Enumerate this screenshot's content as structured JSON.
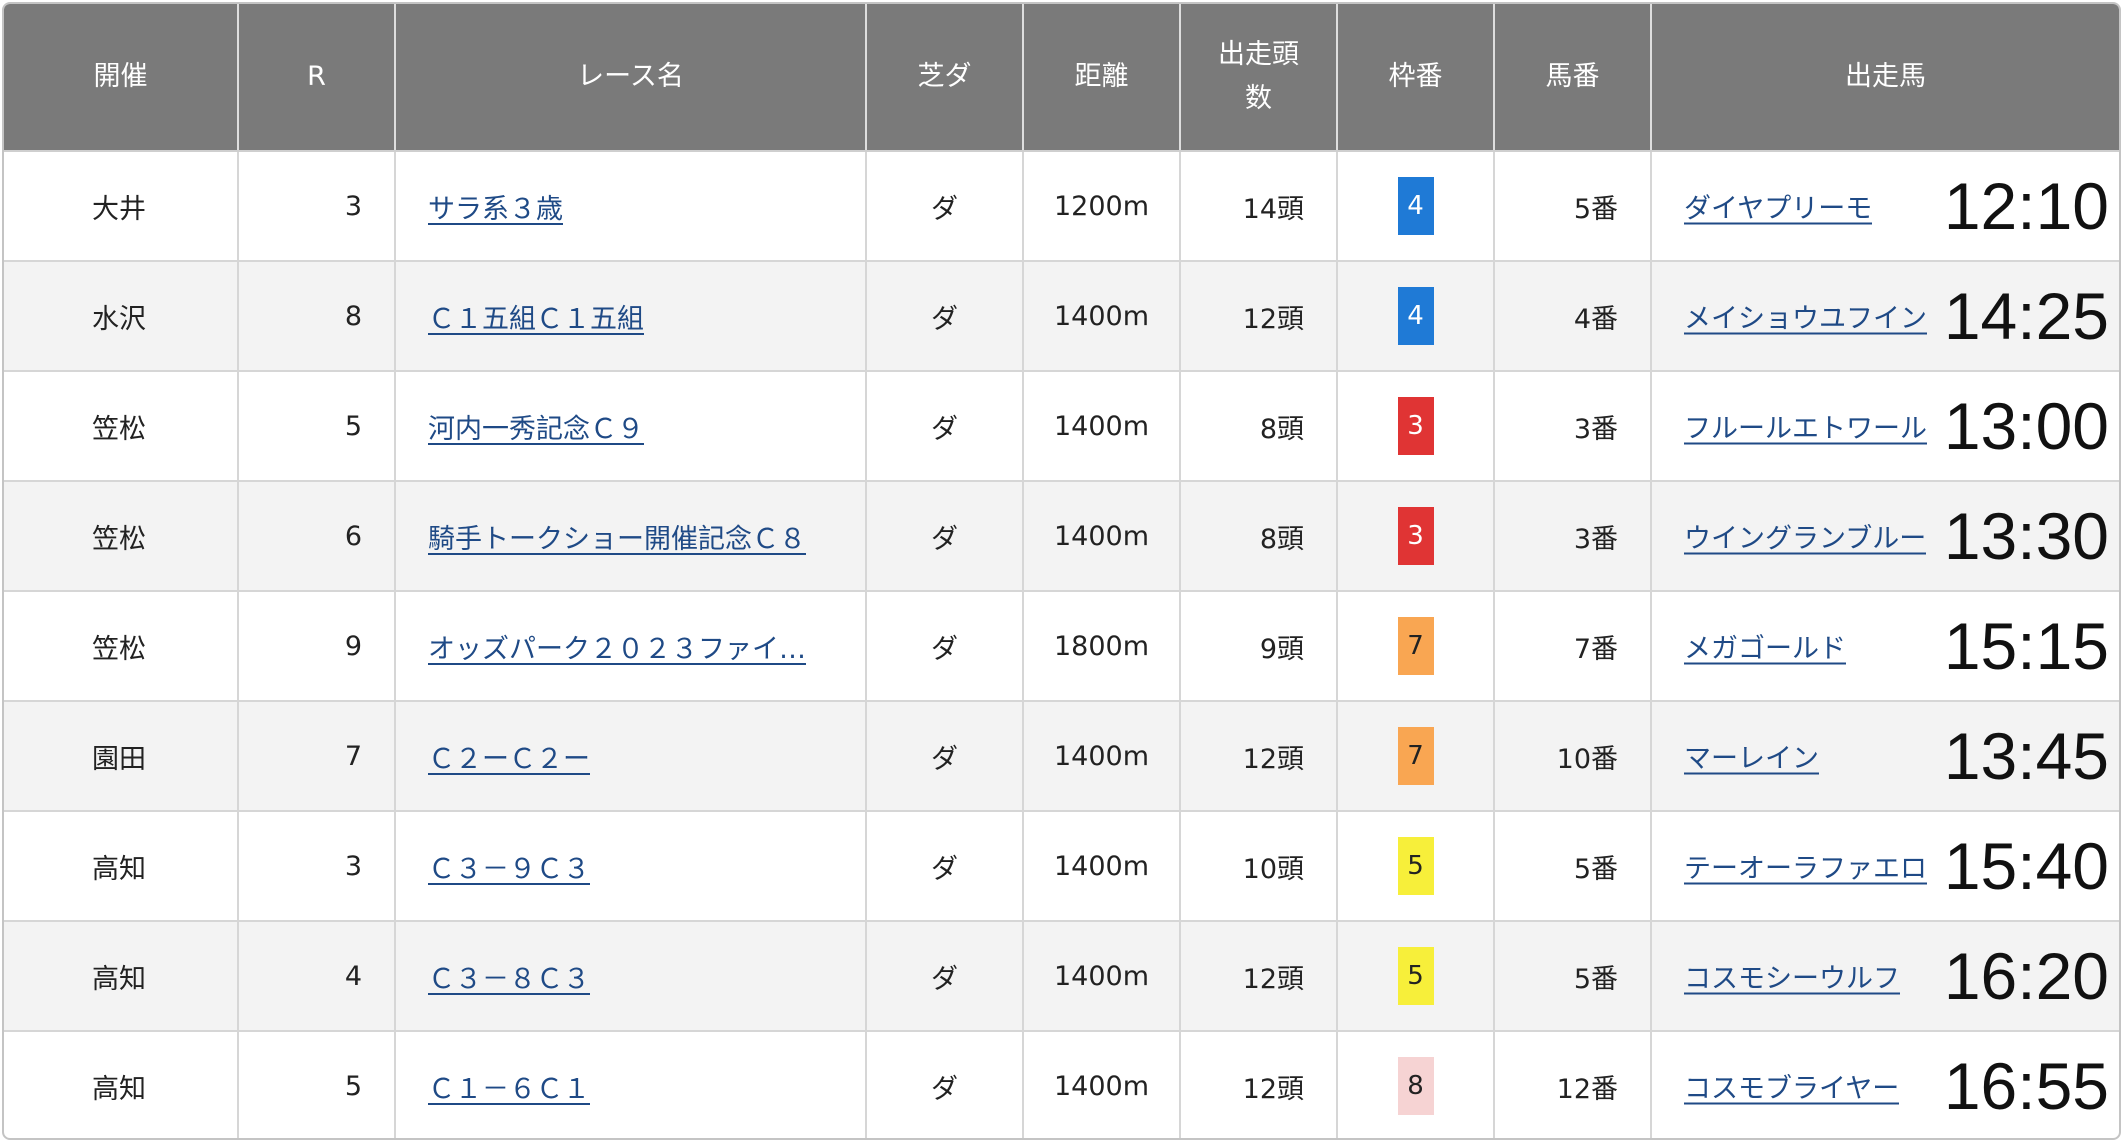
{
  "headers": [
    "開催",
    "R",
    "レース名",
    "芝ダ",
    "距離",
    "出走頭\n数",
    "枠番",
    "馬番",
    "出走馬"
  ],
  "rows": [
    {
      "venue": "大井",
      "race": "3",
      "race_name": "サラ系３歳",
      "surface": "ダ",
      "distance": "1200m",
      "runners": "14頭",
      "frame": "4",
      "frame_bg": "#1f7ad6",
      "frame_fg": "#ffffff",
      "horse_no": "5番",
      "horse": "ダイヤプリーモ",
      "time": "12:10"
    },
    {
      "venue": "水沢",
      "race": "8",
      "race_name": "Ｃ１五組Ｃ１五組",
      "surface": "ダ",
      "distance": "1400m",
      "runners": "12頭",
      "frame": "4",
      "frame_bg": "#1f7ad6",
      "frame_fg": "#ffffff",
      "horse_no": "4番",
      "horse": "メイショウユフイン",
      "time": "14:25"
    },
    {
      "venue": "笠松",
      "race": "5",
      "race_name": "河内一秀記念Ｃ９",
      "surface": "ダ",
      "distance": "1400m",
      "runners": "8頭",
      "frame": "3",
      "frame_bg": "#e03434",
      "frame_fg": "#ffffff",
      "horse_no": "3番",
      "horse": "フルールエトワール",
      "time": "13:00"
    },
    {
      "venue": "笠松",
      "race": "6",
      "race_name": "騎手トークショー開催記念Ｃ８",
      "surface": "ダ",
      "distance": "1400m",
      "runners": "8頭",
      "frame": "3",
      "frame_bg": "#e03434",
      "frame_fg": "#ffffff",
      "horse_no": "3番",
      "horse": "ウイングランブルー",
      "time": "13:30"
    },
    {
      "venue": "笠松",
      "race": "9",
      "race_name": "オッズパーク２０２３ファイ…",
      "surface": "ダ",
      "distance": "1800m",
      "runners": "9頭",
      "frame": "7",
      "frame_bg": "#f9a652",
      "frame_fg": "#222222",
      "horse_no": "7番",
      "horse": "メガゴールド",
      "time": "15:15"
    },
    {
      "venue": "園田",
      "race": "7",
      "race_name": "Ｃ２ーＣ２ー",
      "surface": "ダ",
      "distance": "1400m",
      "runners": "12頭",
      "frame": "7",
      "frame_bg": "#f9a652",
      "frame_fg": "#222222",
      "horse_no": "10番",
      "horse": "マーレイン",
      "time": "13:45"
    },
    {
      "venue": "高知",
      "race": "3",
      "race_name": "Ｃ３－９Ｃ３",
      "surface": "ダ",
      "distance": "1400m",
      "runners": "10頭",
      "frame": "5",
      "frame_bg": "#f7ef3a",
      "frame_fg": "#222222",
      "horse_no": "5番",
      "horse": "テーオーラファエロ",
      "time": "15:40"
    },
    {
      "venue": "高知",
      "race": "4",
      "race_name": "Ｃ３－８Ｃ３",
      "surface": "ダ",
      "distance": "1400m",
      "runners": "12頭",
      "frame": "5",
      "frame_bg": "#f7ef3a",
      "frame_fg": "#222222",
      "horse_no": "5番",
      "horse": "コスモシーウルフ",
      "time": "16:20"
    },
    {
      "venue": "高知",
      "race": "5",
      "race_name": "Ｃ１－６Ｃ１",
      "surface": "ダ",
      "distance": "1400m",
      "runners": "12頭",
      "frame": "8",
      "frame_bg": "#f6d3d3",
      "frame_fg": "#222222",
      "horse_no": "12番",
      "horse": "コスモブライヤー",
      "time": "16:55"
    }
  ]
}
